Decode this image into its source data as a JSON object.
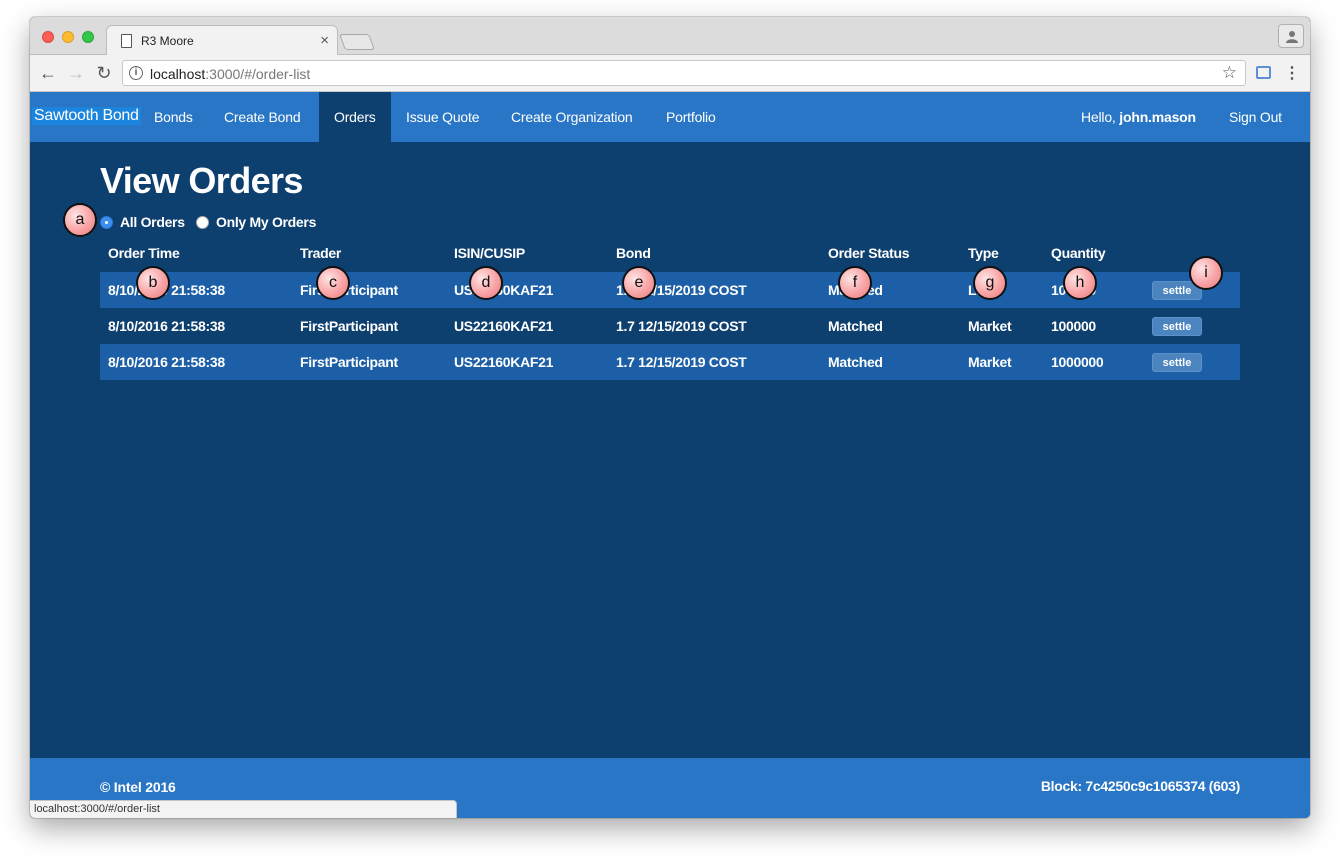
{
  "browser": {
    "tab_title": "R3 Moore",
    "url_host": "localhost",
    "url_rest": ":3000/#/order-list",
    "status_url": "localhost:3000/#/order-list"
  },
  "nav": {
    "brand": "Sawtooth Bond",
    "links": [
      "Bonds",
      "Create Bond",
      "Orders",
      "Issue Quote",
      "Create Organization",
      "Portfolio"
    ],
    "active": "Orders",
    "hello_prefix": "Hello, ",
    "username": "john.mason",
    "sign_out": "Sign Out"
  },
  "page": {
    "title": "View Orders",
    "filter_all": "All Orders",
    "filter_mine": "Only My Orders",
    "selected_filter": "All Orders"
  },
  "table": {
    "headers": [
      "Order Time",
      "Trader",
      "ISIN/CUSIP",
      "Bond",
      "Order Status",
      "Type",
      "Quantity"
    ],
    "action_label": "settle",
    "rows": [
      {
        "time": "8/10/2016 21:58:38",
        "trader": "FirstParticipant",
        "isin": "US22160KAF21",
        "bond": "1.7 12/15/2019 COST",
        "status": "Matched",
        "type": "Limit",
        "quantity": "100000"
      },
      {
        "time": "8/10/2016 21:58:38",
        "trader": "FirstParticipant",
        "isin": "US22160KAF21",
        "bond": "1.7 12/15/2019 COST",
        "status": "Matched",
        "type": "Market",
        "quantity": "100000"
      },
      {
        "time": "8/10/2016 21:58:38",
        "trader": "FirstParticipant",
        "isin": "US22160KAF21",
        "bond": "1.7 12/15/2019 COST",
        "status": "Matched",
        "type": "Market",
        "quantity": "1000000"
      }
    ]
  },
  "footer": {
    "copyright": "© Intel 2016",
    "block": "Block: 7c4250c9c1065374 (603)"
  },
  "markers": [
    "a",
    "b",
    "c",
    "d",
    "e",
    "f",
    "g",
    "h",
    "i"
  ],
  "colors": {
    "nav_bg": "#2876c5",
    "page_bg": "#0d3f6f",
    "row_stripe": "#1c5fa6",
    "marker_fill": "#f8a3a5"
  }
}
